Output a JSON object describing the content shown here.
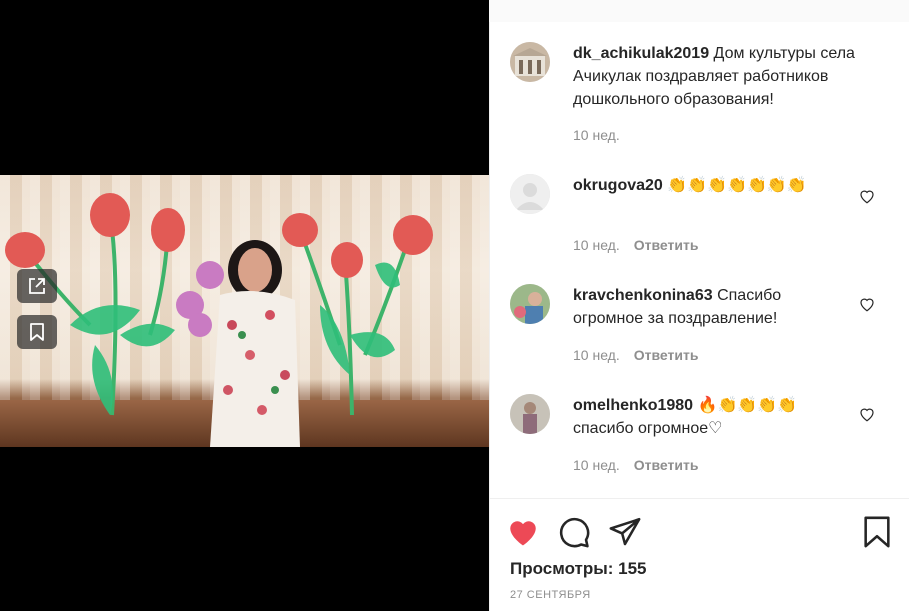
{
  "post": {
    "author": "dk_achikulak2019",
    "caption": "Дом культуры села Ачикулак поздравляет работников дошкольного образования!",
    "time": "10 нед."
  },
  "comments": [
    {
      "user": "okrugova20",
      "text": "👏👏👏👏👏👏👏",
      "time": "10 нед.",
      "reply": "Ответить"
    },
    {
      "user": "kravchenkonina63",
      "text": "Спасибо огромное за поздравление!",
      "time": "10 нед.",
      "reply": "Ответить"
    },
    {
      "user": "omelhenko1980",
      "text": "🔥👏👏👏👏 спасибо огромное♡",
      "time": "10 нед.",
      "reply": "Ответить"
    }
  ],
  "stats": {
    "views": "Просмотры: 155",
    "date": "27 СЕНТЯБРЯ"
  },
  "colors": {
    "like_active": "#ed4956",
    "muted": "#8e8e8e",
    "text": "#262626"
  },
  "icons": [
    "external-link-icon",
    "bookmark-icon",
    "heart-icon",
    "comment-icon",
    "share-icon",
    "save-icon"
  ]
}
